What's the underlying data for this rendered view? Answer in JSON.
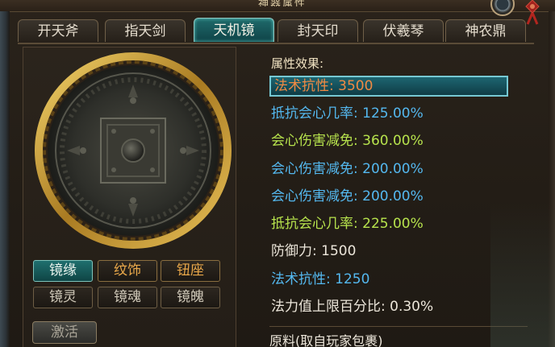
{
  "window": {
    "title": "神器属性"
  },
  "tabs": [
    {
      "label": "开天斧",
      "active": false
    },
    {
      "label": "指天剑",
      "active": false
    },
    {
      "label": "天机镜",
      "active": true
    },
    {
      "label": "封天印",
      "active": false
    },
    {
      "label": "伏羲琴",
      "active": false
    },
    {
      "label": "神农鼎",
      "active": false
    }
  ],
  "artifact": {
    "icon": "bronze-mirror-icon"
  },
  "sub_buttons": {
    "row1": [
      {
        "label": "镜缘",
        "state": "active"
      },
      {
        "label": "纹饰",
        "state": "gold"
      },
      {
        "label": "钮座",
        "state": "gold"
      }
    ],
    "row2": [
      {
        "label": "镜灵",
        "state": "normal"
      },
      {
        "label": "镜魂",
        "state": "normal"
      },
      {
        "label": "镜魄",
        "state": "normal"
      }
    ]
  },
  "activate_button": {
    "label": "激活"
  },
  "attributes": {
    "title": "属性效果:",
    "items": [
      {
        "text": "法术抗性: 3500",
        "color": "#f08a43",
        "selected": true
      },
      {
        "text": "抵抗会心几率: 125.00%",
        "color": "#54b8ef"
      },
      {
        "text": "会心伤害减免: 360.00%",
        "color": "#b7e34d"
      },
      {
        "text": "会心伤害减免: 200.00%",
        "color": "#54b8ef"
      },
      {
        "text": "会心伤害减免: 200.00%",
        "color": "#54b8ef"
      },
      {
        "text": "抵抗会心几率: 225.00%",
        "color": "#b7e34d"
      },
      {
        "text": "防御力: 1500",
        "color": "#ece6da"
      },
      {
        "text": "法术抗性: 1250",
        "color": "#54b8ef"
      },
      {
        "text": "法力值上限百分比:  0.30%",
        "color": "#ece6da"
      }
    ]
  },
  "materials": {
    "title": "原料(取自玩家包裹)"
  }
}
